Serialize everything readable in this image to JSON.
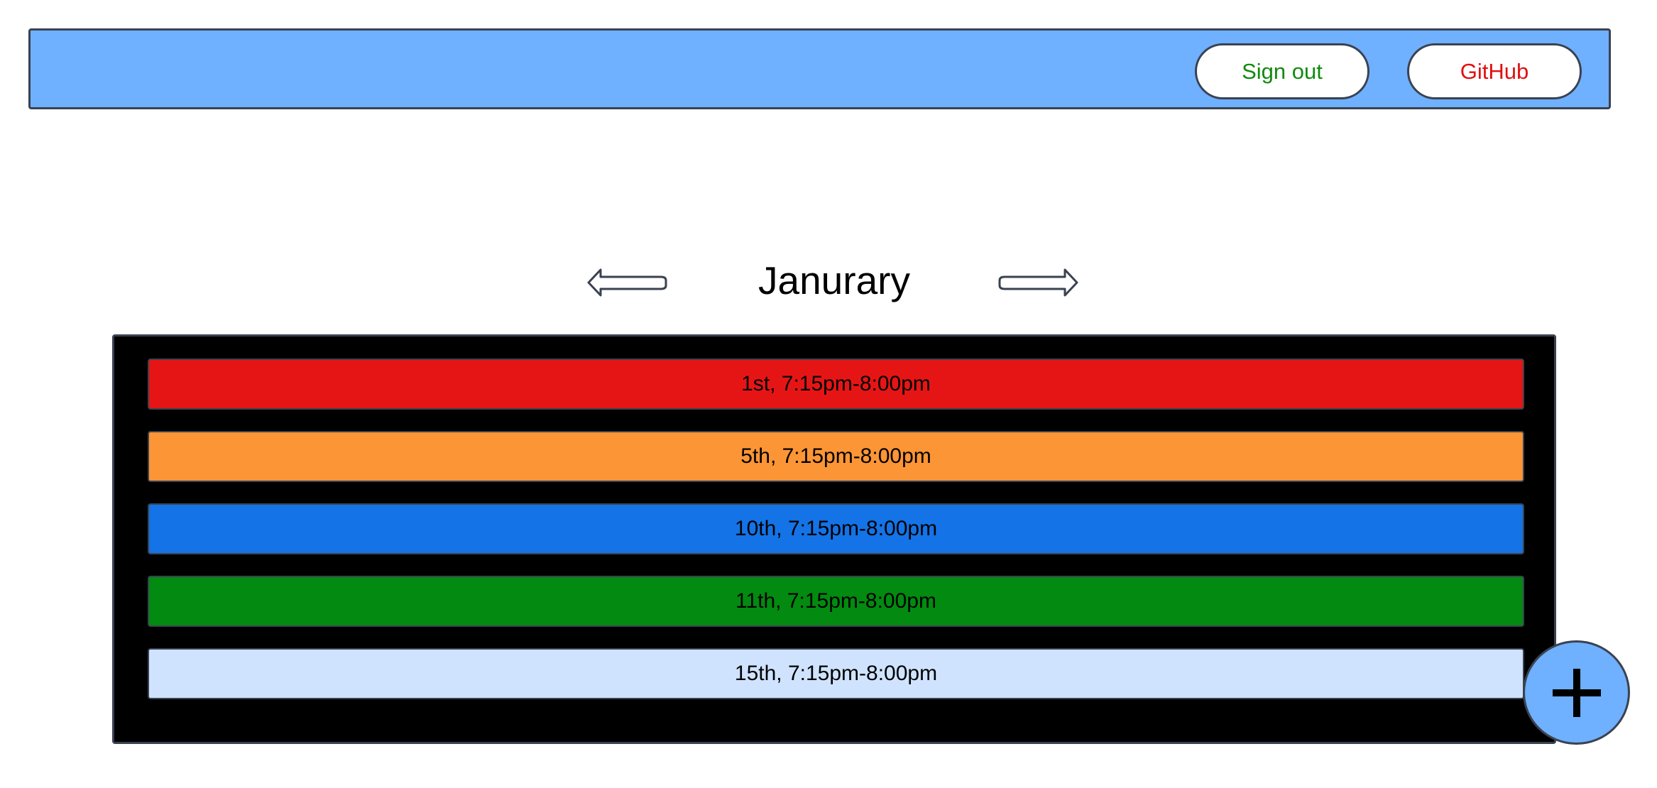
{
  "header": {
    "signout_label": "Sign out",
    "github_label": "GitHub"
  },
  "nav": {
    "month": "Janurary",
    "prev_icon": "left-arrow-icon",
    "next_icon": "right-arrow-icon"
  },
  "events": [
    {
      "label": "1st, 7:15pm-8:00pm",
      "color": "#e61515"
    },
    {
      "label": "5th, 7:15pm-8:00pm",
      "color": "#fc9535"
    },
    {
      "label": "10th, 7:15pm-8:00pm",
      "color": "#1473e6"
    },
    {
      "label": "11th, 7:15pm-8:00pm",
      "color": "#038a10"
    },
    {
      "label": "15th, 7:15pm-8:00pm",
      "color": "#cfe3ff"
    }
  ],
  "fab": {
    "icon": "plus-icon",
    "color": "#6fb0ff"
  },
  "colors": {
    "topbar": "#6fb0ff",
    "panel": "#000000",
    "signout_text": "#118a0e",
    "github_text": "#e01010"
  }
}
